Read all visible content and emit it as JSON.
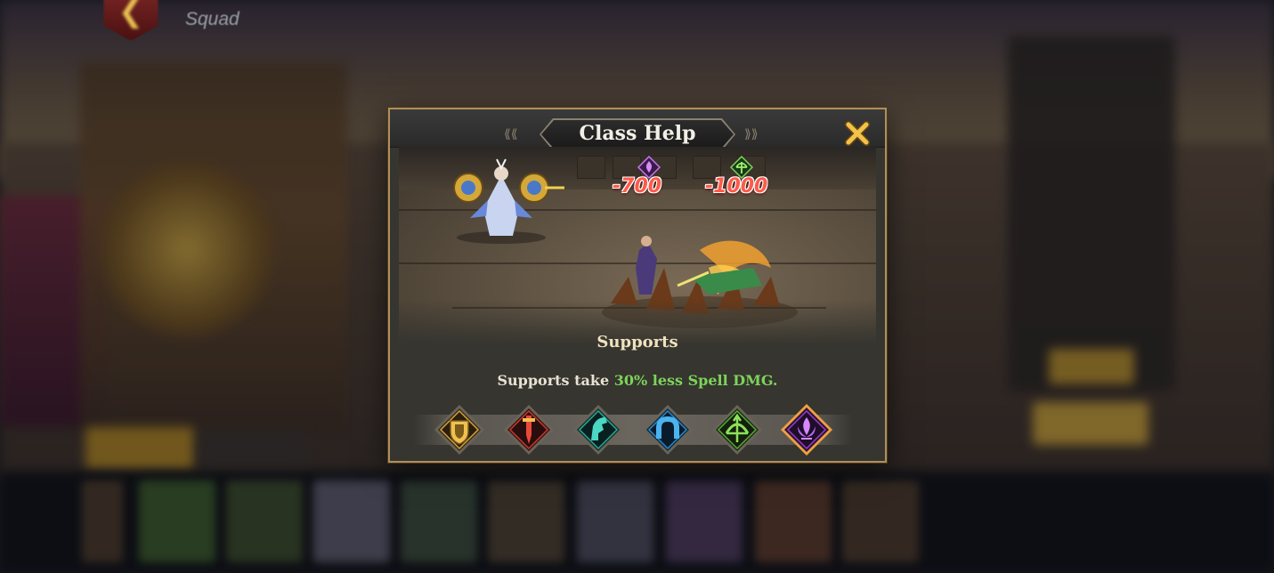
{
  "topbar": {
    "back_icon": "back-arrow-icon",
    "title": "Squad"
  },
  "dialog": {
    "title": "Class Help",
    "close_icon": "close-x-icon",
    "scene": {
      "damage_spell": "-700",
      "damage_physical": "-1000",
      "spell_icon": "support-class-icon",
      "physical_icon": "ranger-class-icon"
    },
    "class_name": "Supports",
    "description": {
      "prefix": "Supports take ",
      "highlight": "30% less Spell DMG."
    },
    "classes": [
      {
        "name": "tank",
        "icon": "shield-icon",
        "color": "#d4a43a",
        "selected": false
      },
      {
        "name": "warrior",
        "icon": "sword-icon",
        "color": "#c53a2c",
        "selected": false
      },
      {
        "name": "assassin",
        "icon": "horse-head-icon",
        "color": "#2aa89a",
        "selected": false
      },
      {
        "name": "mage",
        "icon": "horseshoe-magnet-icon",
        "color": "#2a8ac8",
        "selected": false
      },
      {
        "name": "ranger",
        "icon": "bow-arrow-icon",
        "color": "#5aa83a",
        "selected": false
      },
      {
        "name": "support",
        "icon": "lotus-flame-icon",
        "color": "#9a3ac8",
        "selected": true
      }
    ]
  },
  "colors": {
    "highlight_green": "#7ed35a",
    "damage_red": "#ff5a4a",
    "dialog_border": "#b08f5a",
    "selected_border": "#f0a040"
  }
}
